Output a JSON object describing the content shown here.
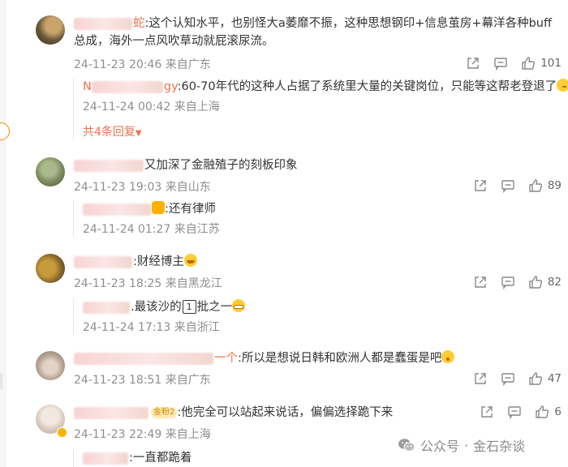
{
  "comments": [
    {
      "text": ":这个认知水平，也别怪大a萎靡不振，这种思想钢印+信息茧房+幕洋各种buff总成，海外一点风吹草动就屁滚尿流。",
      "time": "24-11-23 20:46",
      "location": "来自广东",
      "likes": "101",
      "reply": {
        "name_visible": "N",
        "name_tail": "gy",
        "text": ":60-70年代的这种人占据了系统里大量的关键岗位，只能等这帮老登退了",
        "time": "24-11-24 00:42",
        "location": "来自上海"
      },
      "more_replies": "共4条回复"
    },
    {
      "text": "又加深了金融殖子的刻板印象",
      "time": "24-11-23 19:03",
      "location": "来自山东",
      "likes": "89",
      "reply": {
        "text": ":还有律师",
        "time": "24-11-24 01:27",
        "location": "来自江苏"
      }
    },
    {
      "text": ":财经博主",
      "time": "24-11-23 18:25",
      "location": "来自黑龙江",
      "likes": "82",
      "reply": {
        "text_a": ".最该沙的",
        "box": "1",
        "text_b": "批之一",
        "time": "24-11-24 17:13",
        "location": "来自浙江"
      }
    },
    {
      "name_tail": "一个",
      "text": ":所以是想说日韩和欧洲人都是蠢蛋是吧",
      "time": "24-11-23 18:51",
      "location": "来自广东",
      "likes": "47"
    },
    {
      "badge": "金粉2",
      "text": ":他完全可以站起来说话，偏偏选择跪下来",
      "time": "24-11-23 22:49",
      "location": "来自上海",
      "likes": "6",
      "reply": {
        "text": ":一直都跪着"
      }
    }
  ],
  "watermark": {
    "brand": "公众号",
    "dot": "·",
    "account": "金石杂谈"
  },
  "icons": {
    "share": "share-icon",
    "comment": "comment-icon",
    "like": "like-icon",
    "wechat": "wechat-icon"
  },
  "colors": {
    "accent": "#eb7350",
    "meta": "#8e8e8e",
    "text": "#333333"
  }
}
